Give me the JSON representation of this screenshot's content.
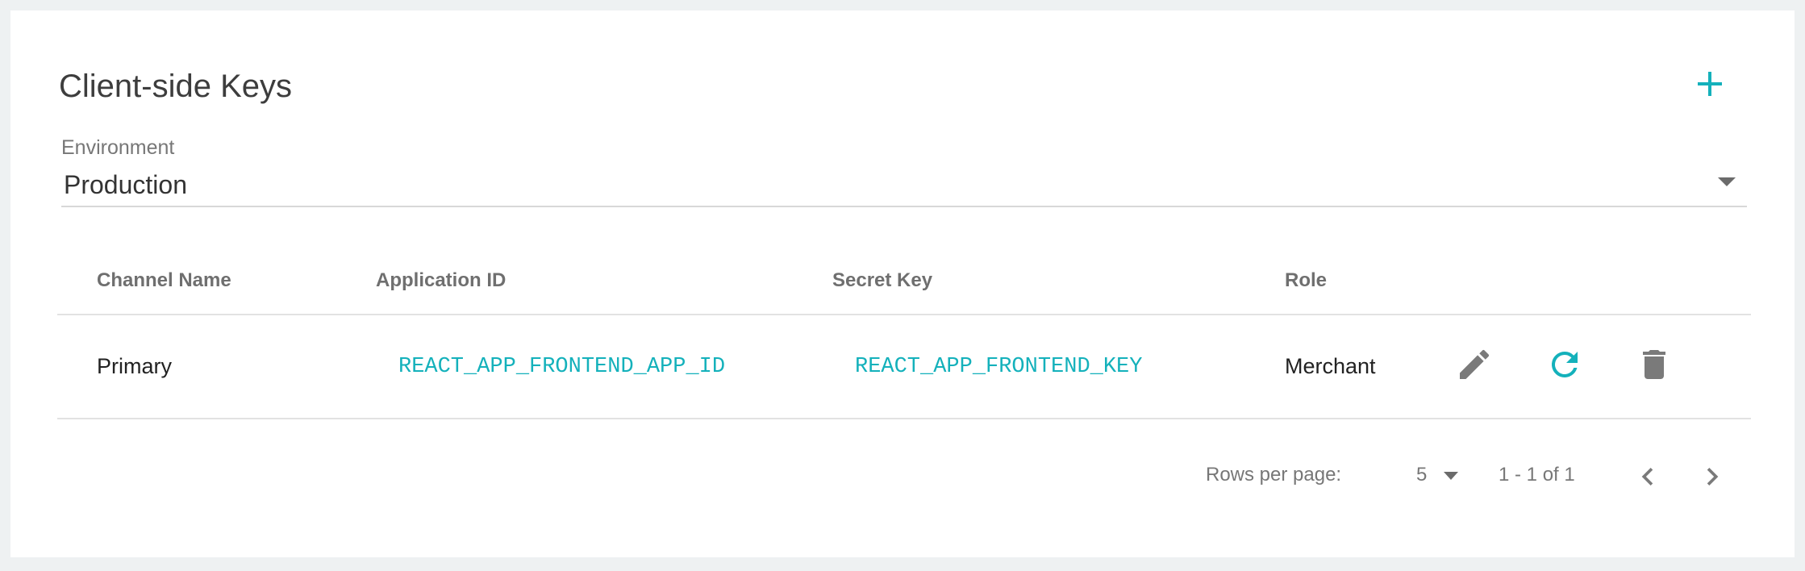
{
  "header": {
    "title": "Client-side Keys",
    "add_icon": "plus-icon"
  },
  "environment": {
    "label": "Environment",
    "value": "Production"
  },
  "table": {
    "columns": [
      "Channel Name",
      "Application ID",
      "Secret Key",
      "Role"
    ],
    "rows": [
      {
        "channel_name": "Primary",
        "application_id": "REACT_APP_FRONTEND_APP_ID",
        "secret_key": "REACT_APP_FRONTEND_KEY",
        "role": "Merchant",
        "actions": [
          "pencil-icon",
          "refresh-icon",
          "trash-icon"
        ]
      }
    ]
  },
  "pagination": {
    "rows_per_page_label": "Rows per page:",
    "rows_per_page": "5",
    "range": "1 - 1 of 1"
  },
  "colors": {
    "accent": "#14b1bb",
    "icon_gray": "#7a7a7a",
    "background": "#eef1f2"
  }
}
